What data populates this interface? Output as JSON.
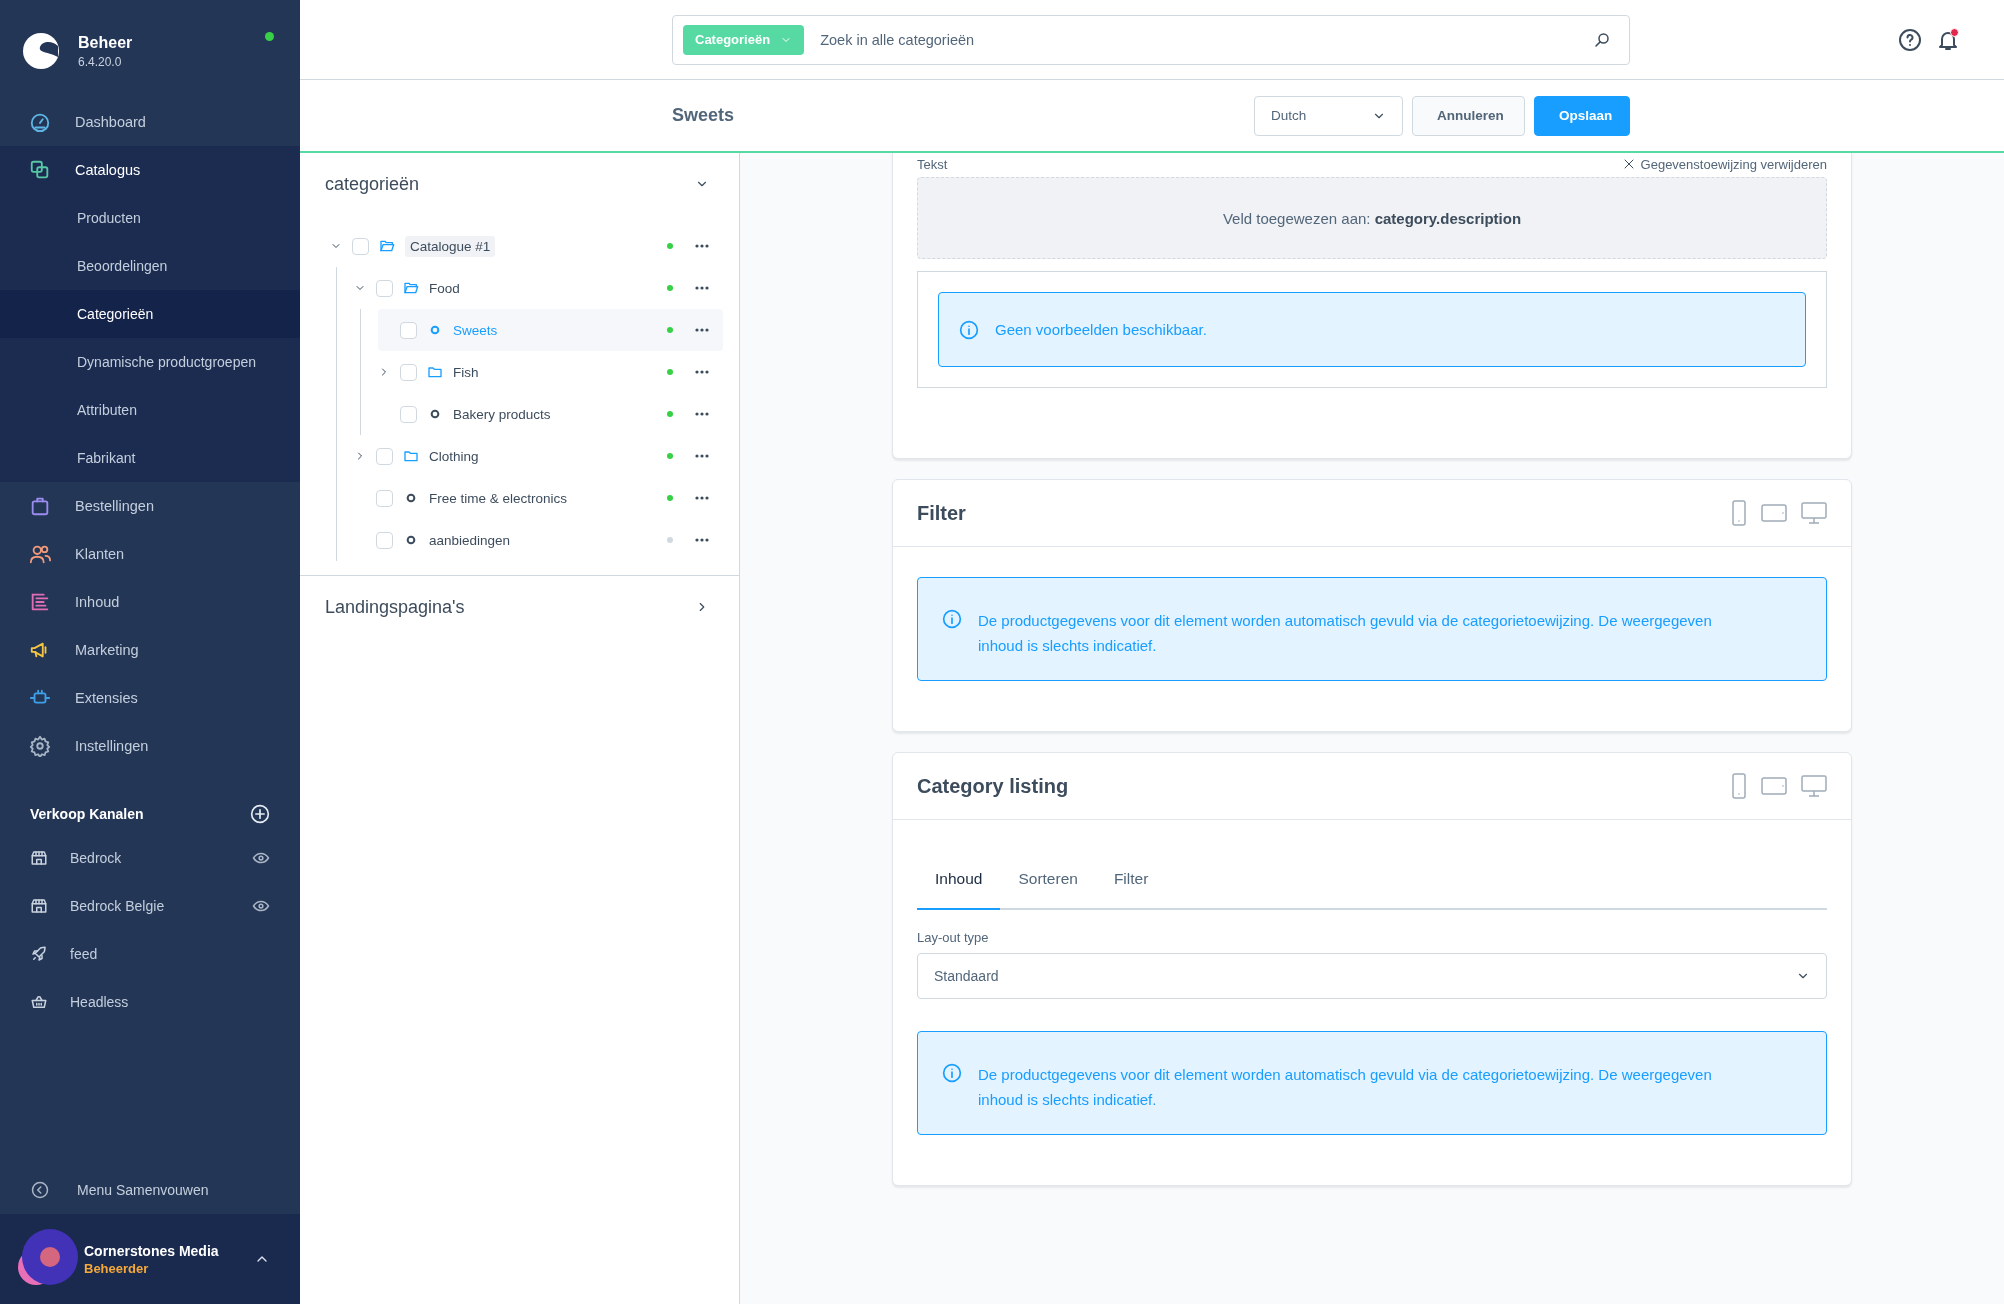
{
  "sidebar": {
    "brand": {
      "title": "Beheer",
      "version": "6.4.20.0",
      "online": true
    },
    "navigation": [
      {
        "label": "Dashboard",
        "selected": false
      },
      {
        "label": "Catalogus",
        "selected": true,
        "expanded": true,
        "children": [
          {
            "label": "Producten",
            "selected": false
          },
          {
            "label": "Beoordelingen",
            "selected": false
          },
          {
            "label": "Categorieën",
            "selected": true
          },
          {
            "label": "Dynamische productgroepen",
            "selected": false
          },
          {
            "label": "Attributen",
            "selected": false
          },
          {
            "label": "Fabrikant",
            "selected": false
          }
        ]
      },
      {
        "label": "Bestellingen",
        "selected": false
      },
      {
        "label": "Klanten",
        "selected": false
      },
      {
        "label": "Inhoud",
        "selected": false
      },
      {
        "label": "Marketing",
        "selected": false
      },
      {
        "label": "Extensies",
        "selected": false
      },
      {
        "label": "Instellingen",
        "selected": false
      }
    ],
    "sales_channels": {
      "title": "Verkoop Kanalen",
      "items": [
        {
          "label": "Bedrock",
          "kind": "storefront"
        },
        {
          "label": "Bedrock Belgie",
          "kind": "storefront"
        },
        {
          "label": "feed",
          "kind": "feed"
        },
        {
          "label": "Headless",
          "kind": "headless"
        }
      ]
    },
    "collapse_label": "Menu Samenvouwen",
    "user": {
      "name": "Cornerstones Media",
      "role": "Beheerder"
    }
  },
  "header": {
    "search": {
      "scope": "Categorieën",
      "placeholder": "Zoek in alle categorieën"
    },
    "notifications": {
      "unread": true
    }
  },
  "toolbar": {
    "title": "Sweets",
    "language": "Dutch",
    "buttons": [
      {
        "label": "Annuleren",
        "kind": "secondary"
      },
      {
        "label": "Opslaan",
        "kind": "primary"
      }
    ]
  },
  "category_panel": {
    "sections": [
      {
        "title": "categorieën",
        "expanded": true,
        "tree": [
          {
            "label": "Catalogue #1",
            "kind": "folder",
            "expanded": true,
            "checked": false,
            "selected": false,
            "active": true,
            "children": [
              {
                "label": "Food",
                "kind": "folder",
                "expanded": true,
                "checked": false,
                "selected": false,
                "active": true,
                "children": [
                  {
                    "label": "Sweets",
                    "kind": "leaf",
                    "checked": false,
                    "selected": true,
                    "active": true
                  },
                  {
                    "label": "Fish",
                    "kind": "folder",
                    "expanded": false,
                    "checked": false,
                    "selected": false,
                    "active": true
                  },
                  {
                    "label": "Bakery products",
                    "kind": "leaf",
                    "checked": false,
                    "selected": false,
                    "active": true
                  }
                ]
              },
              {
                "label": "Clothing",
                "kind": "folder",
                "expanded": false,
                "checked": false,
                "selected": false,
                "active": true
              },
              {
                "label": "Free time & electronics",
                "kind": "leaf",
                "checked": false,
                "selected": false,
                "active": true
              },
              {
                "label": "aanbiedingen",
                "kind": "leaf",
                "checked": false,
                "selected": false,
                "active": false
              }
            ]
          }
        ]
      },
      {
        "title": "Landingspagina's",
        "expanded": false
      }
    ]
  },
  "cards": [
    {
      "kind": "text",
      "field_label": "Tekst",
      "unmap_label": "Gegevenstoewijzing verwijderen",
      "mapping": "Veld toegewezen aan: **category.description**",
      "notice": "Geen voorbeelden beschikbaar."
    },
    {
      "kind": "filter",
      "title": "Filter",
      "notice": "De productgegevens voor dit element worden automatisch gevuld via de categorietoewijzing. De weergegeven inhoud is slechts indicatief."
    },
    {
      "kind": "listing",
      "title": "Category listing",
      "tabs": [
        {
          "label": "Inhoud",
          "selected": true
        },
        {
          "label": "Sorteren",
          "selected": false
        },
        {
          "label": "Filter",
          "selected": false
        }
      ],
      "field_label": "Lay-out type",
      "value": "Standaard",
      "notice": "De productgegevens voor dit element worden automatisch gevuld via de categorietoewijzing. De weergegeven inhoud is slechts indicatief."
    }
  ]
}
